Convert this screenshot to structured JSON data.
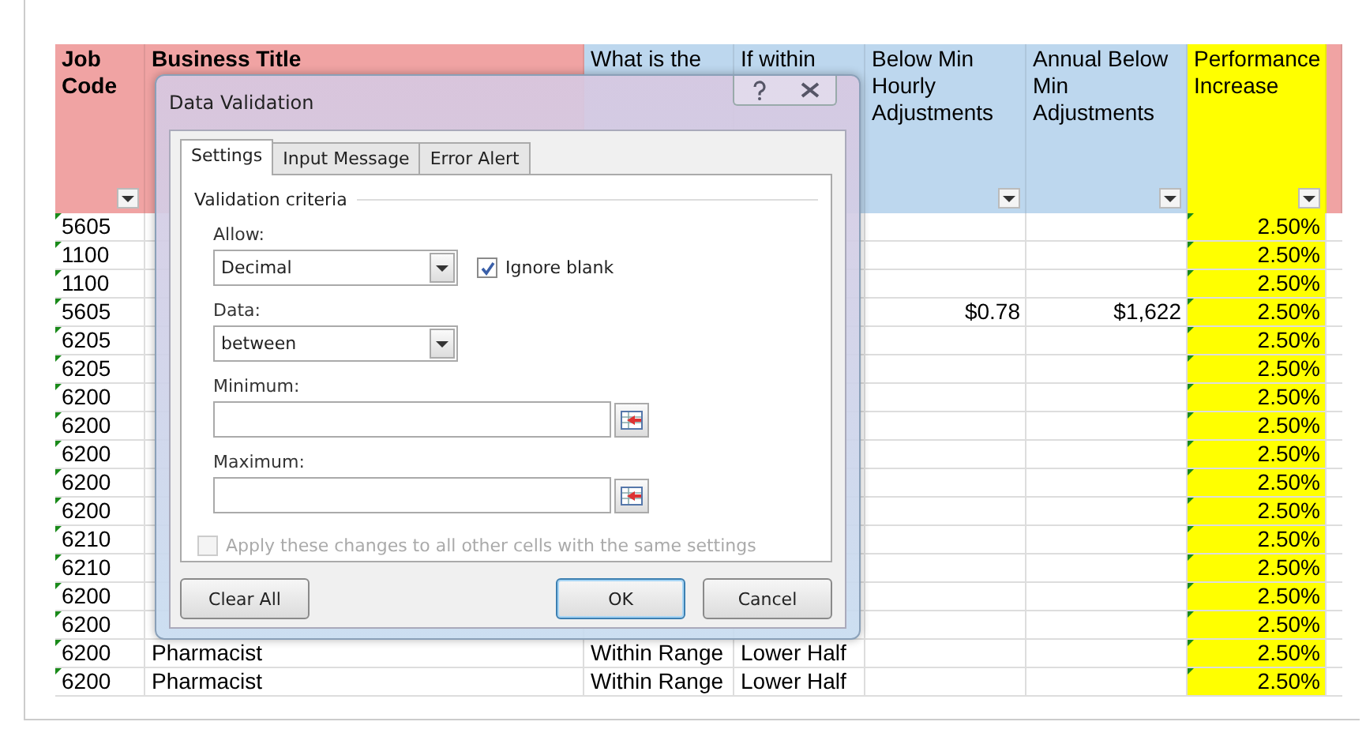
{
  "sheet": {
    "columns": [
      {
        "label": "Job Code",
        "color": "#f0a3a3",
        "filter": true
      },
      {
        "label": "Business Title",
        "color": "#f0a3a3"
      },
      {
        "label": "What is the",
        "color": "#bdd7ee"
      },
      {
        "label": "If within",
        "color": "#bdd7ee"
      },
      {
        "label": "Below Min Hourly Adjustments",
        "color": "#bdd7ee",
        "filter": true
      },
      {
        "label": "Annual Below Min Adjustments",
        "color": "#bdd7ee",
        "filter": true
      },
      {
        "label": "Performance Increase",
        "color": "#ffff00",
        "filter": true
      },
      {
        "color": "#f0a3a3",
        "filter": false
      }
    ],
    "rows": [
      {
        "job_code": "5605",
        "performance_increase": "2.50%",
        "flagged": true
      },
      {
        "job_code": "1100",
        "performance_increase": "2.50%",
        "flagged": true
      },
      {
        "job_code": "1100",
        "performance_increase": "2.50%",
        "flagged": true
      },
      {
        "job_code": "5605",
        "below_min_hourly": "$0.78",
        "annual_below_min": "$1,622",
        "performance_increase": "2.50%",
        "flagged": true
      },
      {
        "job_code": "6205",
        "performance_increase": "2.50%",
        "flagged": true
      },
      {
        "job_code": "6205",
        "performance_increase": "2.50%",
        "flagged": true
      },
      {
        "job_code": "6200",
        "performance_increase": "2.50%",
        "flagged": true
      },
      {
        "job_code": "6200",
        "performance_increase": "2.50%",
        "flagged": true
      },
      {
        "job_code": "6200",
        "performance_increase": "2.50%",
        "flagged": true
      },
      {
        "job_code": "6200",
        "performance_increase": "2.50%",
        "flagged": true
      },
      {
        "job_code": "6200",
        "performance_increase": "2.50%",
        "flagged": true
      },
      {
        "job_code": "6210",
        "performance_increase": "2.50%",
        "flagged": true
      },
      {
        "job_code": "6210",
        "performance_increase": "2.50%",
        "flagged": true
      },
      {
        "job_code": "6200",
        "performance_increase": "2.50%",
        "flagged": true
      },
      {
        "job_code": "6200",
        "performance_increase": "2.50%",
        "flagged": true
      },
      {
        "job_code": "6200",
        "business_title": "Pharmacist",
        "range_status": "Within Range",
        "range_half": "Lower Half",
        "performance_increase": "2.50%",
        "flagged": true
      },
      {
        "job_code": "6200",
        "business_title": "Pharmacist",
        "range_status": "Within Range",
        "range_half": "Lower Half",
        "performance_increase": "2.50%",
        "flagged": true
      }
    ]
  },
  "dialog": {
    "title": "Data Validation",
    "tabs": [
      {
        "label": "Settings",
        "selected": true
      },
      {
        "label": "Input Message",
        "selected": false
      },
      {
        "label": "Error Alert",
        "selected": false
      }
    ],
    "group_title": "Validation criteria",
    "allow": {
      "label": "Allow:",
      "value": "Decimal"
    },
    "ignore_blank": {
      "label": "Ignore blank",
      "checked": true
    },
    "data": {
      "label": "Data:",
      "value": "between"
    },
    "minimum": {
      "label": "Minimum:"
    },
    "maximum": {
      "label": "Maximum:"
    },
    "apply_all": {
      "label": "Apply these changes to all other cells with the same settings",
      "checked": false,
      "disabled": true
    },
    "buttons": [
      {
        "label": "Clear All",
        "default": false
      },
      {
        "label": "OK",
        "default": true
      },
      {
        "label": "Cancel",
        "default": false
      }
    ]
  }
}
